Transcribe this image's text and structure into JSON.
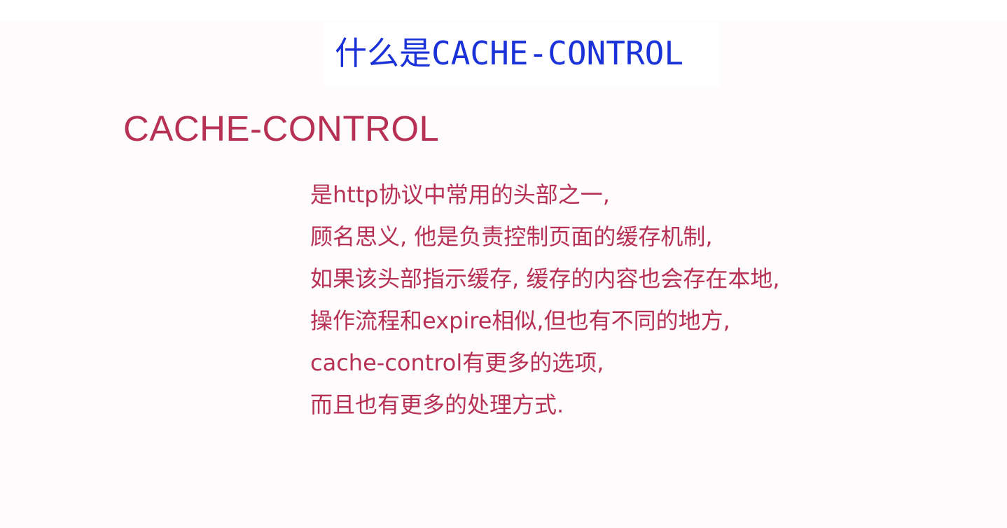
{
  "page_title": "什么是CACHE-CONTROL",
  "section_heading": "CACHE-CONTROL",
  "body_lines": [
    "是http协议中常用的头部之一,",
    "顾名思义, 他是负责控制页面的缓存机制,",
    "如果该头部指示缓存, 缓存的内容也会存在本地,",
    "操作流程和expire相似,但也有不同的地方,",
    "cache-control有更多的选项,",
    "而且也有更多的处理方式."
  ],
  "colors": {
    "title": "#1a32d8",
    "text": "#b73154",
    "background": "#fdfbfc"
  }
}
